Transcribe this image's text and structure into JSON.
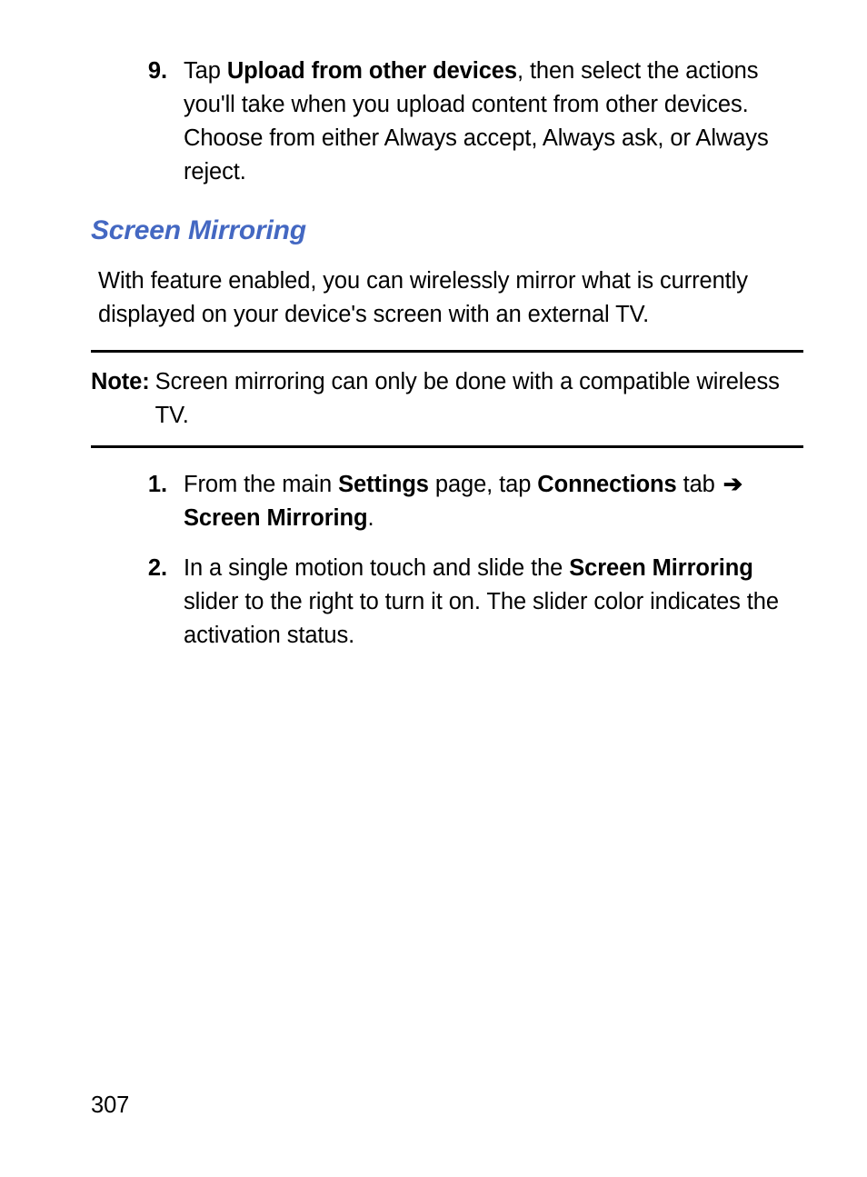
{
  "step9": {
    "num": "9.",
    "pre": "Tap ",
    "bold": "Upload from other devices",
    "post": ", then select the actions you'll take when you upload content from other devices. Choose from either Always accept, Always ask, or Always reject."
  },
  "heading": "Screen Mirroring",
  "intro": "With feature enabled, you can wirelessly mirror what is currently displayed on your device's screen with an external TV.",
  "note": {
    "label": "Note:",
    "text": "Screen mirroring can only be done with a compatible wireless TV."
  },
  "step1": {
    "num": "1.",
    "t1": "From the main ",
    "b1": "Settings",
    "t2": " page, tap ",
    "b2": "Connections",
    "t3": " tab ",
    "arrow": "➔",
    "b3": " Screen Mirroring",
    "t4": "."
  },
  "step2": {
    "num": "2.",
    "t1": "In a single motion touch and slide the ",
    "b1": "Screen Mirroring",
    "t2": " slider to the right to turn it on. The slider color indicates the activation status."
  },
  "pageNumber": "307"
}
